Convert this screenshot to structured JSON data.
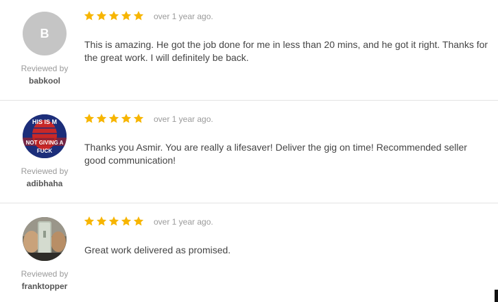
{
  "reviews": [
    {
      "avatar_letter": "B",
      "avatar_type": "letter",
      "reviewed_by_label": "Reviewed by",
      "username": "babkool",
      "rating": 5,
      "time": "over 1 year ago.",
      "text": "This is amazing. He got the job done for me in less than 20 mins, and he got it right. Thanks for the great work. I will definitely be back."
    },
    {
      "avatar_type": "meme-image",
      "avatar_text_top": "HIS IS M",
      "avatar_text_mid": "NOT GIVING A",
      "avatar_text_bottom": "FUCK",
      "reviewed_by_label": "Reviewed by",
      "username": "adibhaha",
      "rating": 5,
      "time": "over 1 year ago.",
      "text": "Thanks you Asmir. You are really a lifesaver! Deliver the gig on time! Recommended seller good communication!"
    },
    {
      "avatar_type": "photo",
      "reviewed_by_label": "Reviewed by",
      "username": "franktopper",
      "rating": 5,
      "time": "over 1 year ago.",
      "text": "Great work delivered as promised."
    }
  ],
  "colors": {
    "star": "#f7b500",
    "muted_text": "#9a9a9a",
    "body_text": "#444444",
    "divider": "#e2e2e2"
  }
}
